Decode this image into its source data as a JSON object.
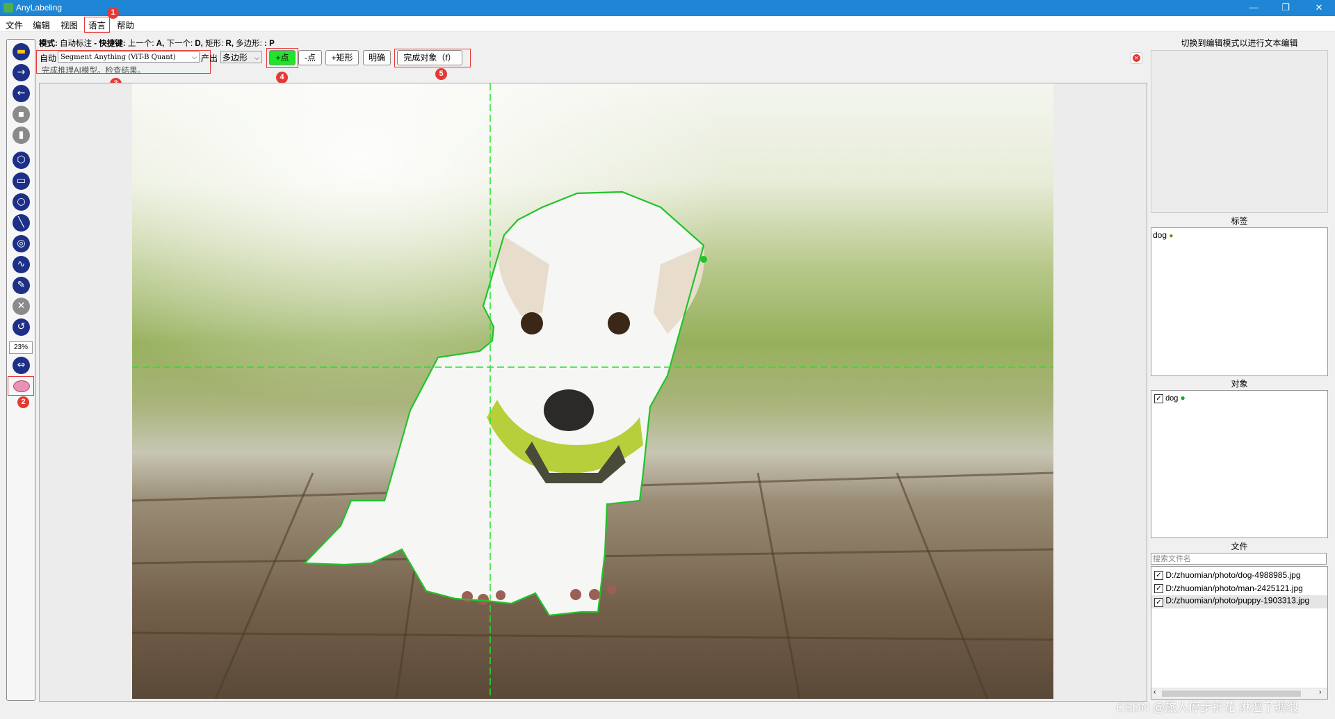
{
  "window": {
    "title": "AnyLabeling",
    "min": "—",
    "max": "❐",
    "close": "✕"
  },
  "menu": [
    "文件",
    "编辑",
    "视图",
    "语言",
    "帮助"
  ],
  "mode_line": {
    "label": "模式:",
    "mode": "自动标注",
    "dash": "-",
    "shortcut_label": "快捷键:",
    "prev": "上一个:",
    "prev_key": "A,",
    "next": "下一个:",
    "next_key": "D,",
    "rect": "矩形:",
    "rect_key": "R,",
    "poly": "多边形:",
    "poly_key": ": P"
  },
  "auto": {
    "label": "自动",
    "model": "Segment Anything (ViT-B Quant)",
    "output_label": "产出",
    "output": "多边形"
  },
  "buttons": {
    "add_point": "+点",
    "remove_point": "-点",
    "add_rect": "+矩形",
    "clear": "明确",
    "finish": "完成对象（f）"
  },
  "status": "完成推理AI模型。检查结果。",
  "badges": [
    "1",
    "2",
    "3",
    "4",
    "5"
  ],
  "zoom": "23%",
  "right": {
    "edit_hint": "切换到编辑模式以进行文本编辑",
    "labels_title": "标签",
    "labels": [
      {
        "name": "dog",
        "color": "#8a7a00"
      }
    ],
    "objects_title": "对象",
    "objects": [
      {
        "name": "dog",
        "color": "#1fa81f",
        "checked": true
      }
    ],
    "files_title": "文件",
    "search_placeholder": "搜索文件名",
    "files": [
      {
        "path": "D:/zhuomian/photo/dog-4988985.jpg",
        "checked": true
      },
      {
        "path": "D:/zhuomian/photo/man-2425121.jpg",
        "checked": true
      },
      {
        "path": "D:/zhuomian/photo/puppy-1903313.jpg",
        "checked": true
      }
    ]
  },
  "watermark": "CSDN @旅人停步折花 淋湿了绸缎",
  "colors": {
    "titlebar": "#1e86d4",
    "toolbar_icon": "#1d2f86",
    "outline": "#22c32b",
    "highlight": "#e53935",
    "add_point_bg": "#22e22b"
  },
  "icons": [
    "open-icon",
    "next-icon",
    "prev-icon",
    "save-icon",
    "delete-icon",
    "polygon-icon",
    "rectangle-icon",
    "circle-icon",
    "line-icon",
    "point-icon",
    "linestrip-icon",
    "edit-icon",
    "delete-shape-icon",
    "undo-icon",
    "fit-width-icon",
    "brain-icon"
  ]
}
